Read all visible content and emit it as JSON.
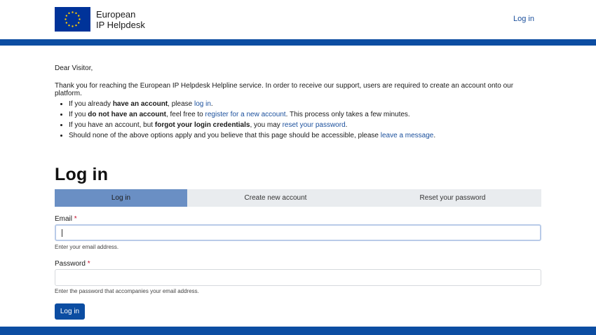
{
  "header": {
    "brand_line1": "European",
    "brand_line2": "IP Helpdesk",
    "login_link": "Log in"
  },
  "notice": {
    "greeting": "Dear Visitor,",
    "intro": "Thank you for reaching the European IP Helpdesk Helpline service. In order to receive our support, users are required to create an account onto our platform.",
    "bullets": [
      {
        "pre": "If you already ",
        "bold": "have an account",
        "mid": ", please ",
        "link": "log in",
        "post": "."
      },
      {
        "pre": "If you ",
        "bold": "do not have an account",
        "mid": ", feel free to ",
        "link": "register for a new account",
        "post": ". This process only takes a few minutes."
      },
      {
        "pre": "If you have an account, but ",
        "bold": "forgot your login credentials",
        "mid": ", you may ",
        "link": "reset your password",
        "post": "."
      },
      {
        "pre": "Should none of the above options apply and you believe that this page should be accessible, please ",
        "bold": "",
        "mid": "",
        "link": "leave a message",
        "post": "."
      }
    ]
  },
  "page_title": "Log in",
  "tabs": [
    "Log in",
    "Create new account",
    "Reset your password"
  ],
  "form": {
    "email_label": "Email",
    "email_required": "*",
    "email_help": "Enter your email address.",
    "password_label": "Password",
    "password_required": "*",
    "password_help": "Enter the password that accompanies your email address.",
    "submit_label": "Log in"
  },
  "colors": {
    "brand_blue": "#0c4da2",
    "link_blue": "#1a4f9c",
    "active_tab": "#6a8fc4",
    "required": "#c8102e"
  },
  "icons": {
    "logo": "eu-flag-icon"
  }
}
